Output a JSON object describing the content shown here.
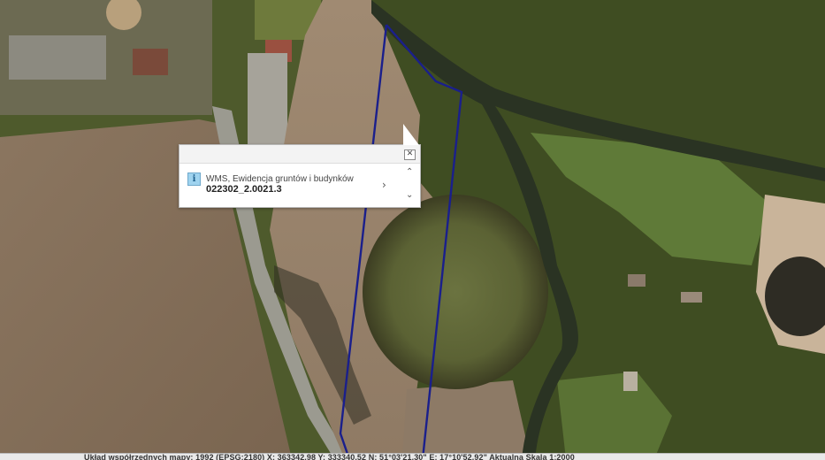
{
  "popup": {
    "layer_name": "WMS, Ewidencja gruntów i budynków",
    "feature_id": "022302_2.0021.3",
    "close_glyph": "✕",
    "next_glyph": "›",
    "up_glyph": "⌃",
    "down_glyph": "⌄",
    "info_glyph": "i"
  },
  "status_bar": {
    "text": "Układ współrzędnych mapy: 1992 (EPSG:2180)   X: 363342.98 Y: 333340.52   N: 51°03'21.30\"  E: 17°10'52.92\"   Aktualna Skala 1:2000"
  },
  "colors": {
    "parcel_boundary": "#1a1f8c",
    "popup_background": "#ffffff"
  }
}
